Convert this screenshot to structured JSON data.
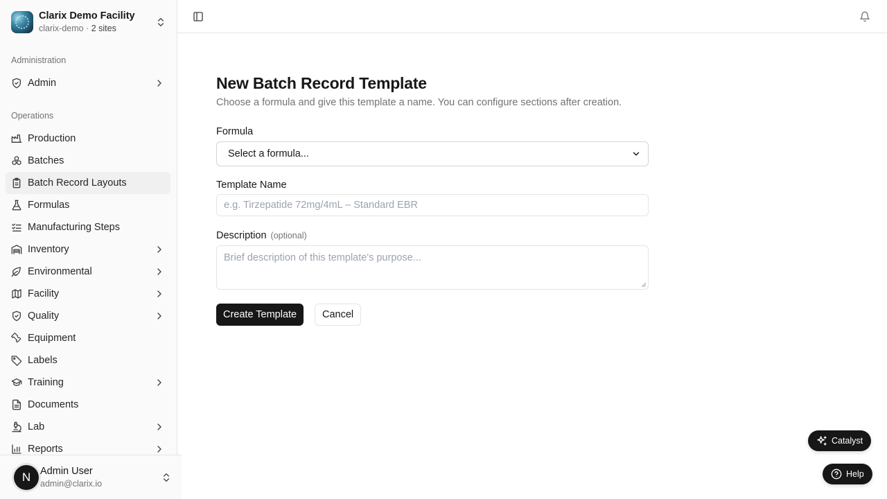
{
  "org": {
    "name": "Clarix Demo Facility",
    "slug": "clarix-demo",
    "separator": " · ",
    "sites": "2 sites"
  },
  "sidebar": {
    "groups": [
      {
        "label": "Administration"
      },
      {
        "label": "Operations"
      }
    ],
    "items": [
      {
        "label": "Admin",
        "icon": "shield-check-icon",
        "has_submenu": true
      },
      {
        "label": "Production",
        "icon": "factory-icon",
        "has_submenu": false
      },
      {
        "label": "Batches",
        "icon": "boxes-icon",
        "has_submenu": false
      },
      {
        "label": "Batch Record Layouts",
        "icon": "clipboard-icon",
        "has_submenu": false,
        "active": true
      },
      {
        "label": "Formulas",
        "icon": "flask-icon",
        "has_submenu": false
      },
      {
        "label": "Manufacturing Steps",
        "icon": "list-checks-icon",
        "has_submenu": false
      },
      {
        "label": "Inventory",
        "icon": "warehouse-icon",
        "has_submenu": true
      },
      {
        "label": "Environmental",
        "icon": "leaf-icon",
        "has_submenu": true
      },
      {
        "label": "Facility",
        "icon": "map-icon",
        "has_submenu": true
      },
      {
        "label": "Quality",
        "icon": "shield-check-icon",
        "has_submenu": true
      },
      {
        "label": "Equipment",
        "icon": "wrench-icon",
        "has_submenu": false
      },
      {
        "label": "Labels",
        "icon": "tag-icon",
        "has_submenu": false
      },
      {
        "label": "Training",
        "icon": "graduation-cap-icon",
        "has_submenu": true
      },
      {
        "label": "Documents",
        "icon": "file-text-icon",
        "has_submenu": false
      },
      {
        "label": "Lab",
        "icon": "microscope-icon",
        "has_submenu": true
      },
      {
        "label": "Reports",
        "icon": "bar-chart-icon",
        "has_submenu": true
      }
    ]
  },
  "user": {
    "initial": "N",
    "name": "Admin User",
    "email": "admin@clarix.io"
  },
  "page": {
    "title": "New Batch Record Template",
    "subtitle": "Choose a formula and give this template a name. You can configure sections after creation.",
    "formula": {
      "label": "Formula",
      "selected": "Select a formula..."
    },
    "template_name": {
      "label": "Template Name",
      "placeholder": "e.g. Tirzepatide 72mg/4mL – Standard EBR"
    },
    "description": {
      "label": "Description",
      "optional": "(optional)",
      "placeholder": "Brief description of this template's purpose..."
    },
    "create_label": "Create Template",
    "cancel_label": "Cancel"
  },
  "floating": {
    "catalyst_label": "Catalyst",
    "help_label": "Help"
  },
  "colors": {
    "primary": "#171717",
    "sidebar_bg": "#fafafa",
    "active_bg": "#f0f0f0",
    "muted_text": "#737373",
    "border": "#e5e5e5"
  }
}
